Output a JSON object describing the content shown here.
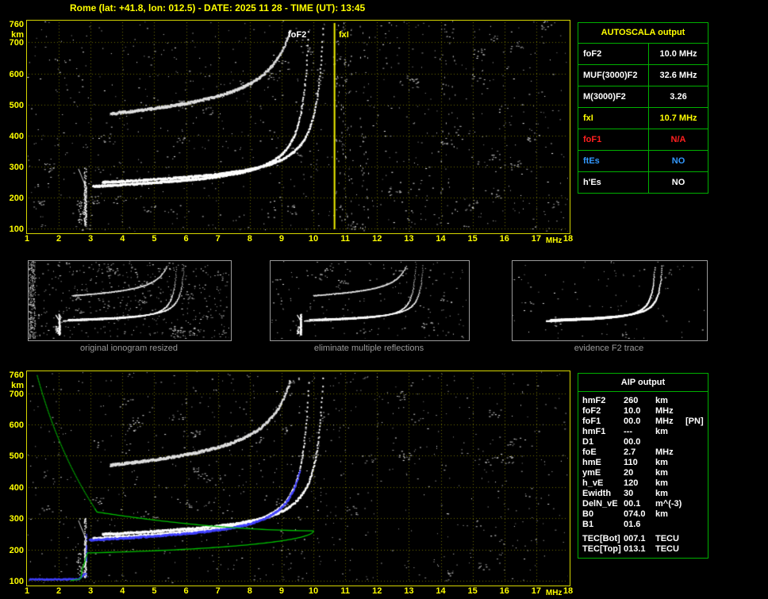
{
  "header": {
    "title": "Rome (lat: +41.8, lon: 012.5) - DATE: 2025 11 28 - TIME (UT): 13:45"
  },
  "top_plot": {
    "foF2_label": "foF2",
    "fxI_label": "fxI",
    "y_unit": "km",
    "x_unit": "MHz"
  },
  "bottom_plot": {
    "y_unit": "km",
    "x_unit": "MHz"
  },
  "autoscala_table": {
    "title": "AUTOSCALA output",
    "rows": [
      {
        "param": "foF2",
        "value": "10.0 MHz",
        "color": "#ffffff"
      },
      {
        "param": "MUF(3000)F2",
        "value": "32.6 MHz",
        "color": "#ffffff"
      },
      {
        "param": "M(3000)F2",
        "value": "3.26",
        "color": "#ffffff"
      },
      {
        "param": "fxI",
        "value": "10.7 MHz",
        "color": "#ffff00"
      },
      {
        "param": "foF1",
        "value": "N/A",
        "color": "#ff2020"
      },
      {
        "param": "ftEs",
        "value": "NO",
        "color": "#3399ff"
      },
      {
        "param": "h'Es",
        "value": "NO",
        "color": "#ffffff"
      }
    ]
  },
  "thumbnails": [
    {
      "caption": "original ionogram resized"
    },
    {
      "caption": "eliminate multiple reflections"
    },
    {
      "caption": "evidence F2 trace"
    }
  ],
  "aip_table": {
    "title": "AIP output",
    "rows": [
      {
        "name": "hmF2",
        "value": "260",
        "unit": "km",
        "extra": "",
        "gap": false
      },
      {
        "name": "foF2",
        "value": "10.0",
        "unit": "MHz",
        "extra": "",
        "gap": false
      },
      {
        "name": "foF1",
        "value": "00.0",
        "unit": "MHz",
        "extra": "[PN]",
        "gap": false
      },
      {
        "name": "hmF1",
        "value": "---",
        "unit": "km",
        "extra": "",
        "gap": false
      },
      {
        "name": "D1",
        "value": "00.0",
        "unit": "",
        "extra": "",
        "gap": false
      },
      {
        "name": "foE",
        "value": "2.7",
        "unit": "MHz",
        "extra": "",
        "gap": false
      },
      {
        "name": "hmE",
        "value": "110",
        "unit": "km",
        "extra": "",
        "gap": false
      },
      {
        "name": "ymE",
        "value": "20",
        "unit": "km",
        "extra": "",
        "gap": false
      },
      {
        "name": "h_vE",
        "value": "120",
        "unit": "km",
        "extra": "",
        "gap": false
      },
      {
        "name": "Ewidth",
        "value": "30",
        "unit": "km",
        "extra": "",
        "gap": false
      },
      {
        "name": "DelN_vE",
        "value": "00.1",
        "unit": "m^(-3)",
        "extra": "",
        "gap": false
      },
      {
        "name": "B0",
        "value": "074.0",
        "unit": "km",
        "extra": "",
        "gap": false
      },
      {
        "name": "B1",
        "value": "01.6",
        "unit": "",
        "extra": "",
        "gap": false
      },
      {
        "name": "TEC[Bot]",
        "value": "007.1",
        "unit": "TECU",
        "extra": "",
        "gap": true
      },
      {
        "name": "TEC[Top]",
        "value": "013.1",
        "unit": "TECU",
        "extra": "",
        "gap": false
      }
    ]
  },
  "chart_data": {
    "type": "scatter",
    "title": "Vertical incidence ionogram - virtual height vs sounding frequency",
    "xlabel": "MHz",
    "ylabel": "km",
    "x_range": [
      1,
      18
    ],
    "y_range": [
      100,
      760
    ],
    "x_ticks": [
      1,
      2,
      3,
      4,
      5,
      6,
      7,
      8,
      9,
      10,
      11,
      12,
      13,
      14,
      15,
      16,
      17,
      18
    ],
    "y_ticks": [
      760,
      700,
      600,
      500,
      400,
      300,
      200,
      100
    ],
    "grid": "dotted",
    "scaled_parameters": {
      "foF2_MHz": 10.0,
      "fxI_MHz": 10.7,
      "MUF3000F2_MHz": 32.6,
      "M3000F2": 3.26,
      "foF1": null,
      "foE_MHz": 2.7,
      "hmF2_km": 260,
      "hmE_km": 110,
      "ymE_km": 20,
      "h_vE_km": 120,
      "Ewidth_km": 30,
      "B0_km": 74.0,
      "B1": 1.6,
      "TEC_bottom_TECU": 7.1,
      "TEC_top_TECU": 13.1
    },
    "traces": {
      "f2_ordinary": {
        "f_start": 3.05,
        "f_critical": 10.0,
        "h_base": 238
      },
      "f2_extraordinary": {
        "f_start": 3.35,
        "f_critical": 10.45,
        "h_base": 251
      },
      "second_hop": {
        "f_start": 3.6,
        "f_end": 9.88
      },
      "e_cusp_freq": 2.82,
      "fxI_marker_freq": 10.65
    },
    "profile": {
      "hmF2": 260,
      "foF2": 10.0,
      "B0": 74,
      "foE": 2.7,
      "hmE": 110,
      "ymE": 20,
      "valley_freq": 2.75
    },
    "thumb_f_range": [
      1,
      13
    ]
  }
}
